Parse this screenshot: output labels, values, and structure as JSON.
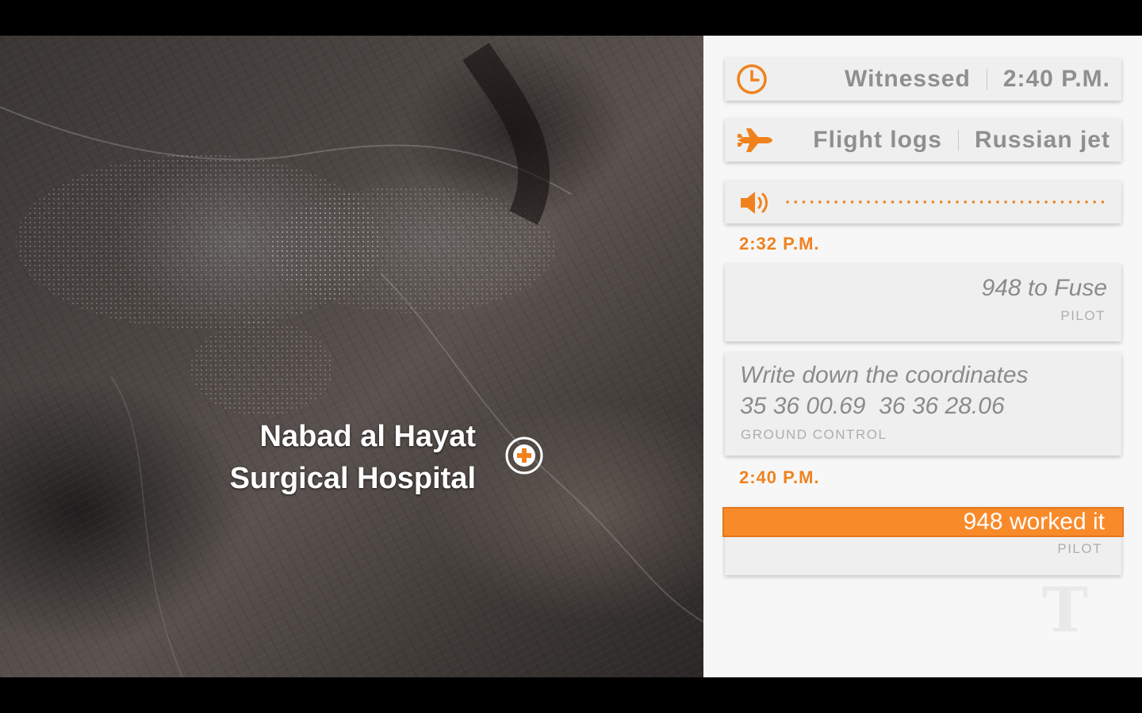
{
  "map": {
    "location_line1": "Nabad al Hayat",
    "location_line2": "Surgical Hospital",
    "marker_icon": "hospital-cross-icon"
  },
  "panel": {
    "witnessed": {
      "icon": "clock-icon",
      "label": "Witnessed",
      "time": "2:40 P.M."
    },
    "flight": {
      "icon": "jet-icon",
      "label": "Flight logs",
      "value": "Russian jet"
    },
    "audio": {
      "icon": "speaker-icon"
    },
    "entries": [
      {
        "time": "2:32 P.M.",
        "quote": "948 to Fuse",
        "speaker": "PILOT"
      },
      {
        "quote_line1": "Write down the coordinates",
        "quote_line2": "35 36 00.69  36 36 28.06",
        "speaker": "GROUND CONTROL"
      },
      {
        "time": "2:40 P.M.",
        "quote": "948 worked it",
        "speaker": "PILOT"
      }
    ],
    "logo_glyph": "T"
  },
  "colors": {
    "accent": "#f0821e",
    "highlight": "#f98a2a",
    "panel_bg": "#f7f7f7",
    "card_bg": "#efefef"
  }
}
